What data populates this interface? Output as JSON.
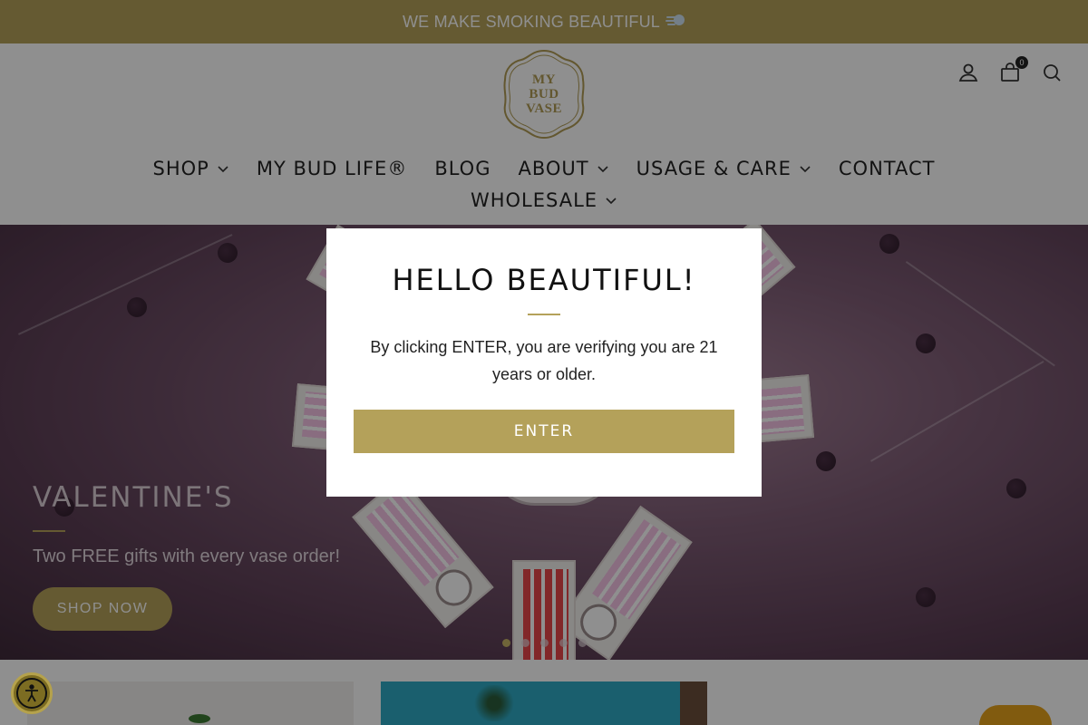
{
  "announcement": {
    "text": "WE MAKE SMOKING BEAUTIFUL",
    "icon": "dash-puff-icon"
  },
  "logo": {
    "line1": "MY",
    "line2": "BUD",
    "line3": "VASE"
  },
  "header_icons": {
    "account": "account-icon",
    "cart": "cart-icon",
    "search": "search-icon",
    "cart_count": "0"
  },
  "nav": {
    "row1": [
      {
        "label": "SHOP",
        "has_dropdown": true
      },
      {
        "label": "MY BUD LIFE®",
        "has_dropdown": false
      },
      {
        "label": "BLOG",
        "has_dropdown": false
      },
      {
        "label": "ABOUT",
        "has_dropdown": true
      },
      {
        "label": "USAGE & CARE",
        "has_dropdown": true
      },
      {
        "label": "CONTACT",
        "has_dropdown": false
      }
    ],
    "row2": [
      {
        "label": "WHOLESALE",
        "has_dropdown": true
      }
    ]
  },
  "hero": {
    "title": "VALENTINE'S",
    "subtitle": "Two FREE gifts with every vase order!",
    "button": "SHOP NOW",
    "slides": 5,
    "active_slide": 1
  },
  "modal": {
    "title": "HELLO BEAUTIFUL!",
    "text": "By clicking ENTER, you are verifying you are 21 years or older.",
    "button": "ENTER"
  },
  "colors": {
    "accent": "#b4a15a",
    "overlay": "rgba(0,0,0,0.44)"
  }
}
